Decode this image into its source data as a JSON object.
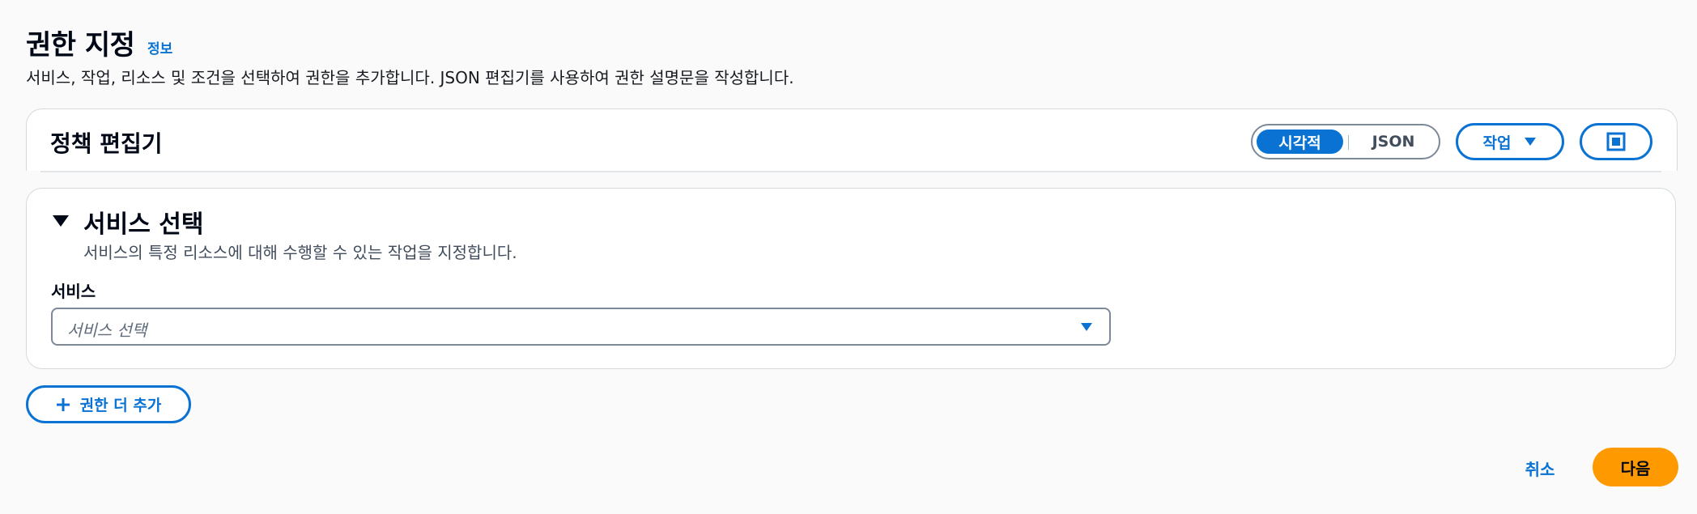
{
  "header": {
    "title": "권한 지정",
    "info_link": "정보",
    "description": "서비스, 작업, 리소스 및 조건을 선택하여 권한을 추가합니다. JSON 편집기를 사용하여 권한 설명문을 작성합니다."
  },
  "editor": {
    "title": "정책 편집기",
    "mode_toggle": {
      "options": [
        "시각적",
        "JSON"
      ],
      "selected": "시각적"
    },
    "actions_label": "작업"
  },
  "service_section": {
    "title": "서비스 선택",
    "description": "서비스의 특정 리소스에 대해 수행할 수 있는 작업을 지정합니다.",
    "field_label": "서비스",
    "placeholder": "서비스 선택"
  },
  "add_permission_label": "권한 더 추가",
  "footer": {
    "cancel_label": "취소",
    "next_label": "다음"
  },
  "colors": {
    "primary": "#0972d3",
    "next_button": "#ff9900",
    "background": "#fafafa"
  },
  "icons": {
    "expand": "expand-icon",
    "caret": "caret-down-icon",
    "add": "plus-icon"
  }
}
